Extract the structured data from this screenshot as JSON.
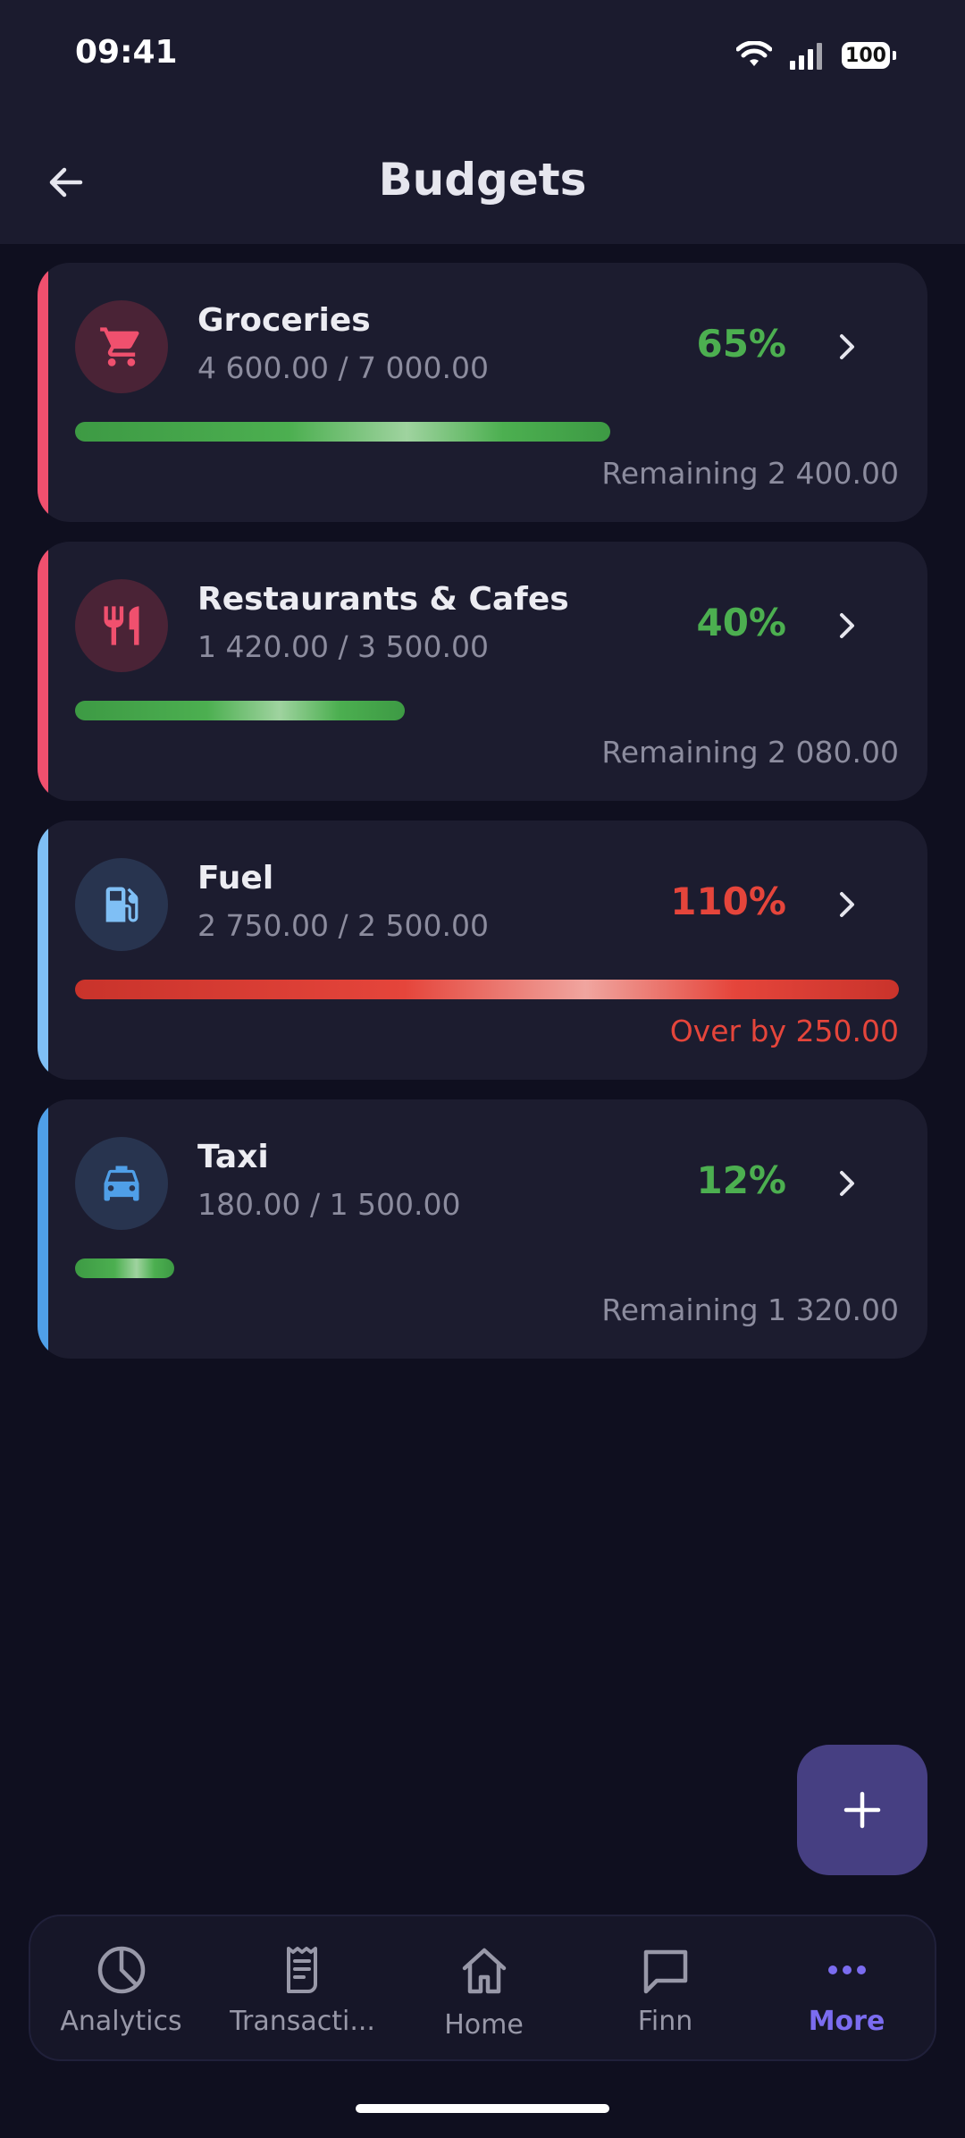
{
  "status": {
    "time": "09:41",
    "battery": "100"
  },
  "header": {
    "title": "Budgets"
  },
  "budgets": [
    {
      "name": "Groceries",
      "amount": "4 600.00 / 7 000.00",
      "percent": "65%",
      "progress": 0.65,
      "footer": "Remaining 2 400.00",
      "icon": "cart-icon",
      "accent": "#f0506e",
      "status": "ok"
    },
    {
      "name": "Restaurants & Cafes",
      "amount": "1 420.00 / 3 500.00",
      "percent": "40%",
      "progress": 0.4,
      "footer": "Remaining 2 080.00",
      "icon": "restaurant-icon",
      "accent": "#f0506e",
      "status": "ok"
    },
    {
      "name": "Fuel",
      "amount": "2 750.00 / 2 500.00",
      "percent": "110%",
      "progress": 1.0,
      "footer": "Over by 250.00",
      "icon": "fuel-icon",
      "accent": "#7fbff5",
      "status": "over"
    },
    {
      "name": "Taxi",
      "amount": "180.00 / 1 500.00",
      "percent": "12%",
      "progress": 0.12,
      "footer": "Remaining 1 320.00",
      "icon": "taxi-icon",
      "accent": "#4f9fe8",
      "status": "ok"
    }
  ],
  "nav": {
    "items": [
      {
        "label": "Analytics",
        "icon": "pie-chart-icon"
      },
      {
        "label": "Transacti...",
        "icon": "receipt-icon"
      },
      {
        "label": "Home",
        "icon": "home-icon"
      },
      {
        "label": "Finn",
        "icon": "chat-icon"
      },
      {
        "label": "More",
        "icon": "more-dots-icon"
      }
    ],
    "active_index": 4
  },
  "colors": {
    "ok": "#4caf50",
    "over": "#e5453b",
    "muted": "#8c8c9e",
    "active": "#7b6cf0"
  }
}
